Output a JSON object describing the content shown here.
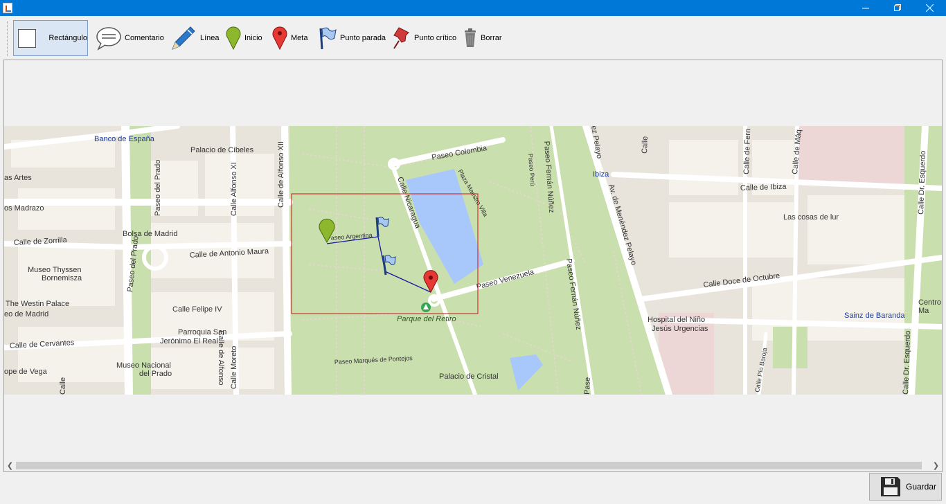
{
  "window": {
    "minimize_icon": "minimize-icon",
    "maximize_icon": "restore-icon",
    "close_icon": "close-icon"
  },
  "toolbar": {
    "tools": [
      {
        "id": "rect",
        "label": "Rectángulo",
        "icon": "rectangle-icon",
        "selected": true
      },
      {
        "id": "comment",
        "label": "Comentario",
        "icon": "speech-bubble-icon"
      },
      {
        "id": "line",
        "label": "Línea",
        "icon": "pencil-icon"
      },
      {
        "id": "start",
        "label": "Inicio",
        "icon": "green-pin-icon"
      },
      {
        "id": "goal",
        "label": "Meta",
        "icon": "red-pin-icon"
      },
      {
        "id": "stop",
        "label": "Punto parada",
        "icon": "flag-icon"
      },
      {
        "id": "critical",
        "label": "Punto crítico",
        "icon": "pushpin-icon"
      },
      {
        "id": "delete",
        "label": "Borrar",
        "icon": "trash-icon"
      }
    ]
  },
  "map": {
    "labels": {
      "banco": "Banco de España",
      "cibeles": "Palacio de Cibeles",
      "artes": "as Artes",
      "madrazo": "os Madrazo",
      "zorrilla": "Calle de Zorrilla",
      "bolsa": "Bolsa de Madrid",
      "antonio_maura": "Calle de Antonio Maura",
      "thyssen1": "Museo Thyssen",
      "thyssen2": "Bornemisza",
      "westin": "The Westin Palace",
      "eo_madrid": "eo de Madrid",
      "felipe": "Calle Felipe IV",
      "parroquia1": "Parroquia San",
      "parroquia2": "Jerónimo El Real",
      "cervantes": "Calle de Cervantes",
      "vega": "ope de Vega",
      "prado_museo1": "Museo Nacional",
      "prado_museo2": "del Prado",
      "paseo_prado": "Paseo del Prado",
      "alfonso_xi": "Calle Alfonso XI",
      "alfonso_xii": "Calle de Alfonso XII",
      "alfonso_xii_b": "Calle de Alfonso",
      "moreto": "Calle Moreto",
      "paseo_colombia": "Paseo Colombia",
      "nicaragua": "Calle Nicaragua",
      "plaza_maestro": "Plaza Maestro Villa",
      "paseo_argentina": "Paseo Argentina",
      "paseo_venezuela": "Paseo Venezuela",
      "parque_retiro": "Parque del Retiro",
      "pontejos": "Paseo Marqués de Pontejos",
      "palacio_cristal": "Palacio de Cristal",
      "fernan_nunez": "Paseo Fernán Núñez",
      "fernan_nunez2": "Paseo Fernán Núñez",
      "paseo_peru": "Paseo Perú",
      "ez_pelayo": "ez Pelayo",
      "menendez": "Av. de Menéndez Pelayo",
      "ibiza_stop": "Ibiza",
      "calle_ibiza": "Calle de Ibiza",
      "cosas_lur": "Las cosas de lur",
      "doce_octubre": "Calle Doce de Octubre",
      "hospital1": "Hospital del Niño",
      "hospital2": "Jesús Urgencias",
      "sainz": "Sainz de Baranda",
      "centro1": "Centro",
      "centro2": "Ma",
      "esquerdo": "Calle Dr. Esquerdo",
      "esquerdo2": "Calle Dr. Esquerdo",
      "pio_baroja": "Calle Pío Baroja",
      "calle_fer": "Calle de Fern",
      "calle_maq": "Calle de Máq",
      "calle_c": "Calle",
      "prado_s": "Paseo del Prado",
      "calle_bot": "Calle",
      "paseo_bot": "Pase"
    },
    "selection_color": "#cc1111",
    "route_color": "#1a1aa0"
  },
  "scrollbar": {
    "left_icon": "chevron-left-icon",
    "right_icon": "chevron-right-icon"
  },
  "save_button": {
    "label": "Guardar",
    "icon": "floppy-disk-icon"
  }
}
